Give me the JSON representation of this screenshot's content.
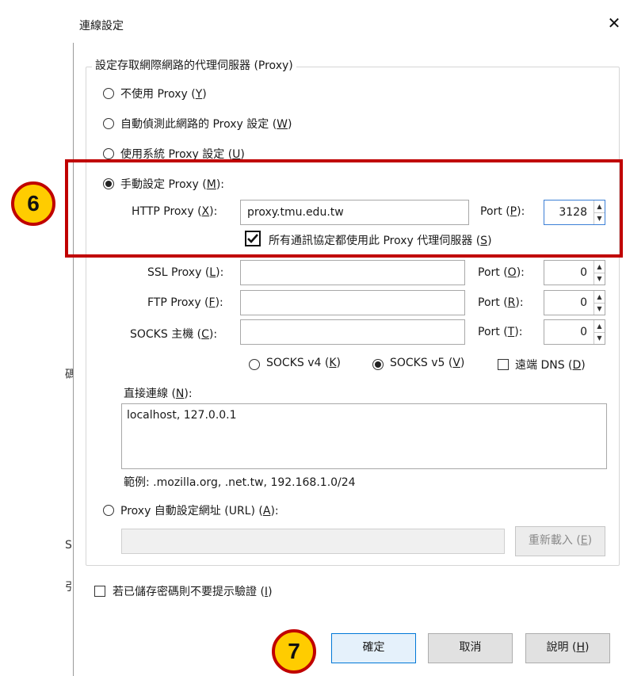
{
  "dialog": {
    "title": "連線設定",
    "close_label": "✕"
  },
  "proxy_group": {
    "legend": "設定存取網際網路的代理伺服器 (Proxy)",
    "options": [
      {
        "label_pre": "不使用 Proxy (",
        "key": "Y",
        "label_post": ")",
        "selected": false
      },
      {
        "label_pre": "自動偵測此網路的 Proxy 設定 (",
        "key": "W",
        "label_post": ")",
        "selected": false
      },
      {
        "label_pre": "使用系統 Proxy 設定 (",
        "key": "U",
        "label_post": ")",
        "selected": false
      },
      {
        "label_pre": "手動設定 Proxy (",
        "key": "M",
        "label_post": "):",
        "selected": true
      }
    ]
  },
  "manual": {
    "http": {
      "label_pre": "HTTP Proxy (",
      "key": "X",
      "label_post": "):",
      "value": "proxy.tmu.edu.tw",
      "port_label_pre": "Port (",
      "port_key": "P",
      "port_label_post": "):",
      "port": "3128"
    },
    "all_protocols": {
      "label_pre": "所有通訊協定都使用此 Proxy 代理伺服器 (",
      "key": "S",
      "label_post": ")",
      "checked": true
    },
    "ssl": {
      "label_pre": "SSL Proxy (",
      "key": "L",
      "label_post": "):",
      "value": "",
      "port_label_pre": "Port (",
      "port_key": "O",
      "port_label_post": "):",
      "port": "0"
    },
    "ftp": {
      "label_pre": "FTP Proxy (",
      "key": "F",
      "label_post": "):",
      "value": "",
      "port_label_pre": "Port (",
      "port_key": "R",
      "port_label_post": "):",
      "port": "0"
    },
    "socks": {
      "label_pre": "SOCKS 主機 (",
      "key": "C",
      "label_post": "):",
      "value": "",
      "port_label_pre": "Port (",
      "port_key": "T",
      "port_label_post": "):",
      "port": "0"
    },
    "socks_v4": {
      "label_pre": "SOCKS v4 (",
      "key": "K",
      "label_post": ")",
      "selected": false
    },
    "socks_v5": {
      "label_pre": "SOCKS v5 (",
      "key": "V",
      "label_post": ")",
      "selected": true
    },
    "remote_dns": {
      "label_pre": "遠端 DNS (",
      "key": "D",
      "label_post": ")",
      "checked": false
    }
  },
  "no_proxy": {
    "label_pre": "直接連線 (",
    "key": "N",
    "label_post": "):",
    "value": "localhost, 127.0.0.1",
    "example": "範例: .mozilla.org, .net.tw, 192.168.1.0/24"
  },
  "auto_url": {
    "label_pre": "Proxy 自動設定網址 (URL) (",
    "key": "A",
    "label_post": "):",
    "selected": false,
    "value": "",
    "reload_label_pre": "重新載入 (",
    "reload_key": "E",
    "reload_label_post": ")"
  },
  "no_prompt": {
    "label_pre": "若已儲存密碼則不要提示驗證 (",
    "key": "I",
    "label_post": ")",
    "checked": false
  },
  "buttons": {
    "ok": "確定",
    "cancel": "取消",
    "help_pre": "說明 (",
    "help_key": "H",
    "help_post": ")"
  },
  "annotations": {
    "step6": "6",
    "step7": "7"
  },
  "background_fragments": [
    "碼",
    "S",
    "引"
  ],
  "colors": {
    "highlight": "#c00000",
    "badge_fill": "#ffcc00",
    "focus_border": "#3c7fd6"
  }
}
